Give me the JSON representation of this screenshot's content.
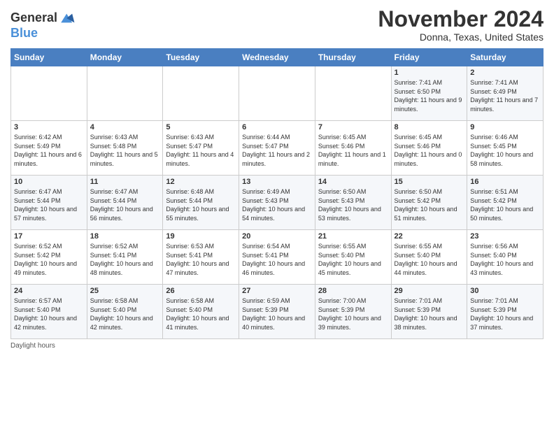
{
  "header": {
    "logo_line1": "General",
    "logo_line2": "Blue",
    "month_year": "November 2024",
    "location": "Donna, Texas, United States"
  },
  "columns": [
    "Sunday",
    "Monday",
    "Tuesday",
    "Wednesday",
    "Thursday",
    "Friday",
    "Saturday"
  ],
  "weeks": [
    [
      {
        "day": "",
        "info": ""
      },
      {
        "day": "",
        "info": ""
      },
      {
        "day": "",
        "info": ""
      },
      {
        "day": "",
        "info": ""
      },
      {
        "day": "",
        "info": ""
      },
      {
        "day": "1",
        "info": "Sunrise: 7:41 AM\nSunset: 6:50 PM\nDaylight: 11 hours and 9 minutes."
      },
      {
        "day": "2",
        "info": "Sunrise: 7:41 AM\nSunset: 6:49 PM\nDaylight: 11 hours and 7 minutes."
      }
    ],
    [
      {
        "day": "3",
        "info": "Sunrise: 6:42 AM\nSunset: 5:49 PM\nDaylight: 11 hours and 6 minutes."
      },
      {
        "day": "4",
        "info": "Sunrise: 6:43 AM\nSunset: 5:48 PM\nDaylight: 11 hours and 5 minutes."
      },
      {
        "day": "5",
        "info": "Sunrise: 6:43 AM\nSunset: 5:47 PM\nDaylight: 11 hours and 4 minutes."
      },
      {
        "day": "6",
        "info": "Sunrise: 6:44 AM\nSunset: 5:47 PM\nDaylight: 11 hours and 2 minutes."
      },
      {
        "day": "7",
        "info": "Sunrise: 6:45 AM\nSunset: 5:46 PM\nDaylight: 11 hours and 1 minute."
      },
      {
        "day": "8",
        "info": "Sunrise: 6:45 AM\nSunset: 5:46 PM\nDaylight: 11 hours and 0 minutes."
      },
      {
        "day": "9",
        "info": "Sunrise: 6:46 AM\nSunset: 5:45 PM\nDaylight: 10 hours and 58 minutes."
      }
    ],
    [
      {
        "day": "10",
        "info": "Sunrise: 6:47 AM\nSunset: 5:44 PM\nDaylight: 10 hours and 57 minutes."
      },
      {
        "day": "11",
        "info": "Sunrise: 6:47 AM\nSunset: 5:44 PM\nDaylight: 10 hours and 56 minutes."
      },
      {
        "day": "12",
        "info": "Sunrise: 6:48 AM\nSunset: 5:44 PM\nDaylight: 10 hours and 55 minutes."
      },
      {
        "day": "13",
        "info": "Sunrise: 6:49 AM\nSunset: 5:43 PM\nDaylight: 10 hours and 54 minutes."
      },
      {
        "day": "14",
        "info": "Sunrise: 6:50 AM\nSunset: 5:43 PM\nDaylight: 10 hours and 53 minutes."
      },
      {
        "day": "15",
        "info": "Sunrise: 6:50 AM\nSunset: 5:42 PM\nDaylight: 10 hours and 51 minutes."
      },
      {
        "day": "16",
        "info": "Sunrise: 6:51 AM\nSunset: 5:42 PM\nDaylight: 10 hours and 50 minutes."
      }
    ],
    [
      {
        "day": "17",
        "info": "Sunrise: 6:52 AM\nSunset: 5:42 PM\nDaylight: 10 hours and 49 minutes."
      },
      {
        "day": "18",
        "info": "Sunrise: 6:52 AM\nSunset: 5:41 PM\nDaylight: 10 hours and 48 minutes."
      },
      {
        "day": "19",
        "info": "Sunrise: 6:53 AM\nSunset: 5:41 PM\nDaylight: 10 hours and 47 minutes."
      },
      {
        "day": "20",
        "info": "Sunrise: 6:54 AM\nSunset: 5:41 PM\nDaylight: 10 hours and 46 minutes."
      },
      {
        "day": "21",
        "info": "Sunrise: 6:55 AM\nSunset: 5:40 PM\nDaylight: 10 hours and 45 minutes."
      },
      {
        "day": "22",
        "info": "Sunrise: 6:55 AM\nSunset: 5:40 PM\nDaylight: 10 hours and 44 minutes."
      },
      {
        "day": "23",
        "info": "Sunrise: 6:56 AM\nSunset: 5:40 PM\nDaylight: 10 hours and 43 minutes."
      }
    ],
    [
      {
        "day": "24",
        "info": "Sunrise: 6:57 AM\nSunset: 5:40 PM\nDaylight: 10 hours and 42 minutes."
      },
      {
        "day": "25",
        "info": "Sunrise: 6:58 AM\nSunset: 5:40 PM\nDaylight: 10 hours and 42 minutes."
      },
      {
        "day": "26",
        "info": "Sunrise: 6:58 AM\nSunset: 5:40 PM\nDaylight: 10 hours and 41 minutes."
      },
      {
        "day": "27",
        "info": "Sunrise: 6:59 AM\nSunset: 5:39 PM\nDaylight: 10 hours and 40 minutes."
      },
      {
        "day": "28",
        "info": "Sunrise: 7:00 AM\nSunset: 5:39 PM\nDaylight: 10 hours and 39 minutes."
      },
      {
        "day": "29",
        "info": "Sunrise: 7:01 AM\nSunset: 5:39 PM\nDaylight: 10 hours and 38 minutes."
      },
      {
        "day": "30",
        "info": "Sunrise: 7:01 AM\nSunset: 5:39 PM\nDaylight: 10 hours and 37 minutes."
      }
    ]
  ],
  "footer": {
    "note": "Daylight hours"
  }
}
